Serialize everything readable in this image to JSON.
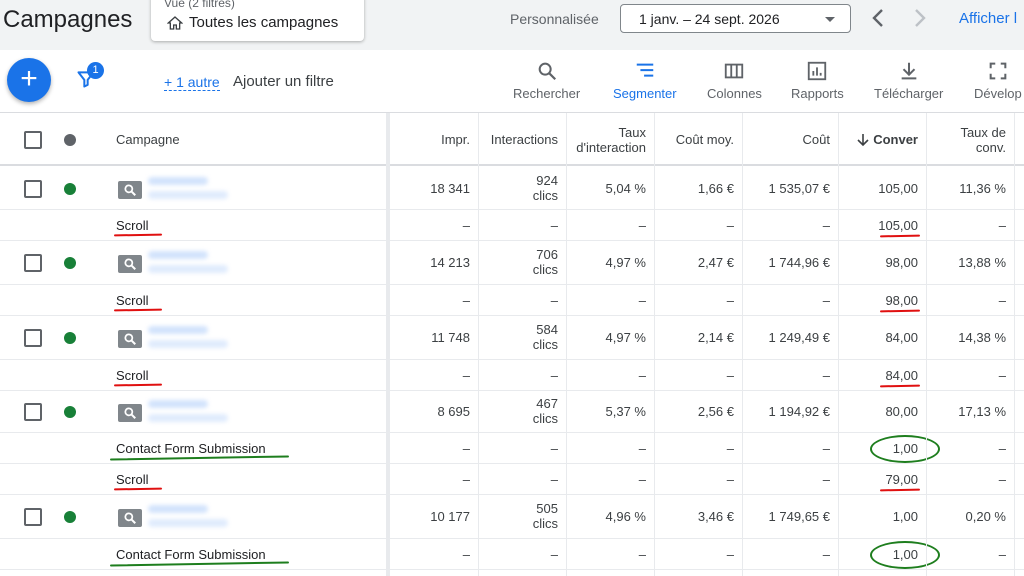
{
  "header": {
    "title": "Campagnes",
    "view_sub": "Vue (2 filtres)",
    "view_main": "Toutes les campagnes",
    "personnalisee": "Personnalisée",
    "date_range": "1 janv. – 24 sept. 2026",
    "afficher": "Afficher l"
  },
  "toolbar": {
    "filter_badge": "1",
    "plus_autre": "+ 1 autre",
    "add_filter": "Ajouter un filtre",
    "tools": [
      "Rechercher",
      "Segmenter",
      "Colonnes",
      "Rapports",
      "Télécharger",
      "Dévelop"
    ]
  },
  "columns": {
    "campagne": "Campagne",
    "impr": "Impr.",
    "interactions": "Interactions",
    "taux_interaction": "Taux d'interaction",
    "cout_moy": "Coût moy.",
    "cout": "Coût",
    "conver": "Conver",
    "taux_conv": "Taux de conv."
  },
  "rows": [
    {
      "impr": "18 341",
      "inter_num": "924",
      "inter_unit": "clics",
      "taux": "5,04 %",
      "cout_moy": "1,66 €",
      "cout": "1 535,07 €",
      "conv": "105,00",
      "taux_conv": "11,36 %"
    },
    {
      "impr": "14 213",
      "inter_num": "706",
      "inter_unit": "clics",
      "taux": "4,97 %",
      "cout_moy": "2,47 €",
      "cout": "1 744,96 €",
      "conv": "98,00",
      "taux_conv": "13,88 %"
    },
    {
      "impr": "11 748",
      "inter_num": "584",
      "inter_unit": "clics",
      "taux": "4,97 %",
      "cout_moy": "2,14 €",
      "cout": "1 249,49 €",
      "conv": "84,00",
      "taux_conv": "14,38 %"
    },
    {
      "impr": "8 695",
      "inter_num": "467",
      "inter_unit": "clics",
      "taux": "5,37 %",
      "cout_moy": "2,56 €",
      "cout": "1 194,92 €",
      "conv": "80,00",
      "taux_conv": "17,13 %"
    },
    {
      "impr": "10 177",
      "inter_num": "505",
      "inter_unit": "clics",
      "taux": "4,96 %",
      "cout_moy": "3,46 €",
      "cout": "1 749,65 €",
      "conv": "1,00",
      "taux_conv": "0,20 %"
    }
  ],
  "segments": [
    {
      "label": "Scroll",
      "conv": "105,00"
    },
    {
      "label": "Scroll",
      "conv": "98,00"
    },
    {
      "label": "Scroll",
      "conv": "84,00"
    },
    {
      "label": "Contact Form Submission",
      "conv": "1,00"
    },
    {
      "label": "Scroll",
      "conv": "79,00"
    },
    {
      "label": "Contact Form Submission",
      "conv": "1,00"
    }
  ],
  "dash": "–"
}
